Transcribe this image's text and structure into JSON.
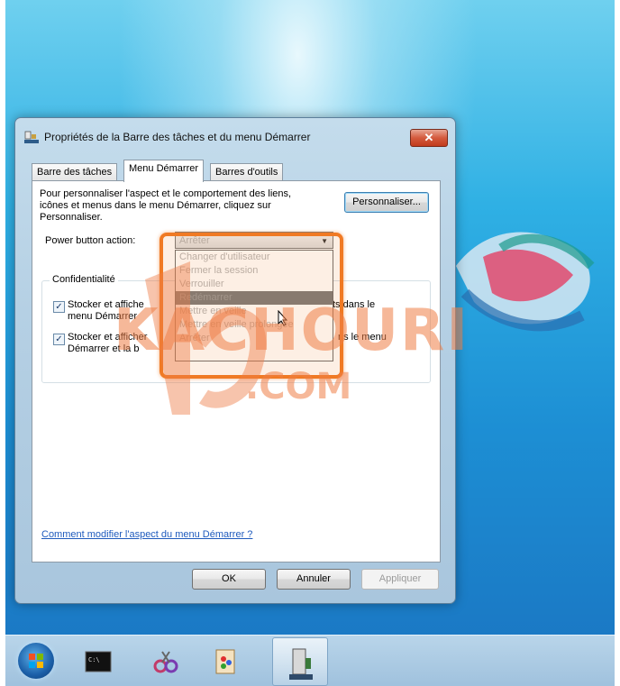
{
  "dialog": {
    "title": "Propriétés de la Barre des tâches et du menu Démarrer",
    "close_label": "✕"
  },
  "tabs": [
    "Barre des tâches",
    "Menu Démarrer",
    "Barres d'outils"
  ],
  "active_tab": "Menu Démarrer",
  "description": "Pour personnaliser l'aspect et le comportement des liens, icônes et menus dans le menu Démarrer, cliquez sur Personnaliser.",
  "personnaliser_label": "Personnaliser...",
  "power_button": {
    "label": "Power button action:",
    "selected": "Arrêter",
    "options": [
      "Changer d'utilisateur",
      "Fermer la session",
      "Verrouiller",
      "Redémarrer",
      "Mettre en veille",
      "Mettre en veille prolongée",
      "Arrêter"
    ],
    "highlighted_option": "Redémarrer"
  },
  "privacy": {
    "title": "Confidentialité",
    "check1_text_a": "Stocker et affiche",
    "check1_text_b": "menu Démarrer",
    "check1_right": "ts dans le",
    "check2_text_a": "Stocker et afficher",
    "check2_text_b": "Démarrer et la b",
    "check2_right": "ns le menu"
  },
  "help_link": "Comment modifier l'aspect du menu Démarrer ?",
  "buttons": {
    "ok": "OK",
    "cancel": "Annuler",
    "apply": "Appliquer"
  },
  "watermark": {
    "main": "KACHOURI",
    "sub": ".COM"
  },
  "colors": {
    "highlight": "#f07a24",
    "link": "#1f5bbd"
  },
  "taskbar_icons": [
    "windows-start-icon",
    "terminal-icon",
    "snipping-tool-icon",
    "paint-icon",
    "taskbar-properties-icon"
  ]
}
